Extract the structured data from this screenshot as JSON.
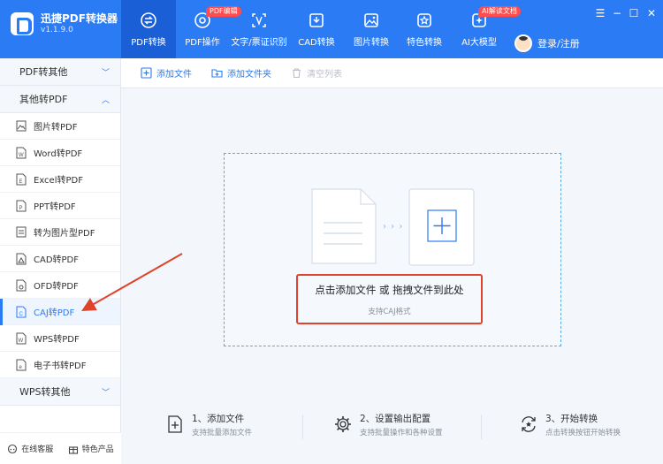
{
  "app": {
    "title": "迅捷PDF转换器",
    "version": "v1.1.9.0"
  },
  "nav": {
    "items": [
      {
        "label": "PDF转换",
        "icon": "pdf-convert-icon"
      },
      {
        "label": "PDF操作",
        "icon": "pdf-operation-icon",
        "badge": "PDF编辑"
      },
      {
        "label": "文字/票证识别",
        "icon": "ocr-frame-icon"
      },
      {
        "label": "CAD转换",
        "icon": "cad-convert-icon"
      },
      {
        "label": "图片转换",
        "icon": "image-convert-icon"
      },
      {
        "label": "特色转换",
        "icon": "feature-convert-icon"
      },
      {
        "label": "AI大模型",
        "icon": "ai-model-icon",
        "badge": "AI解读文档"
      }
    ],
    "login_label": "登录/注册"
  },
  "window": {
    "menu": "☰",
    "minimize": "−",
    "maximize": "☐",
    "close": "✕"
  },
  "sidebar": {
    "section_pdf_to_other": "PDF转其他",
    "section_other_to_pdf": "其他转PDF",
    "items": [
      {
        "label": "图片转PDF",
        "icon": "image-file-icon"
      },
      {
        "label": "Word转PDF",
        "icon": "word-file-icon"
      },
      {
        "label": "Excel转PDF",
        "icon": "excel-file-icon"
      },
      {
        "label": "PPT转PDF",
        "icon": "ppt-file-icon"
      },
      {
        "label": "转为图片型PDF",
        "icon": "image-pdf-file-icon"
      },
      {
        "label": "CAD转PDF",
        "icon": "cad-file-icon"
      },
      {
        "label": "OFD转PDF",
        "icon": "ofd-file-icon"
      },
      {
        "label": "CAJ转PDF",
        "icon": "caj-file-icon",
        "active": true
      },
      {
        "label": "WPS转PDF",
        "icon": "wps-file-icon"
      },
      {
        "label": "电子书转PDF",
        "icon": "ebook-file-icon"
      }
    ],
    "section_wps_to_other": "WPS转其他",
    "footer": {
      "service": "在线客服",
      "featured": "特色产品"
    }
  },
  "toolbar": {
    "add_file": "添加文件",
    "add_folder": "添加文件夹",
    "clear_list": "清空列表"
  },
  "dropzone": {
    "main_text": "点击添加文件 或 拖拽文件到此处",
    "sub_text": "支持CAJ格式",
    "arrows": "› › ›"
  },
  "steps": [
    {
      "title": "1、添加文件",
      "desc": "支持批量添加文件"
    },
    {
      "title": "2、设置输出配置",
      "desc": "支持批量操作和各种设置"
    },
    {
      "title": "3、开始转换",
      "desc": "点击转换按钮开始转换"
    }
  ],
  "colors": {
    "brand": "#2b7bf4",
    "highlight": "#e0432b",
    "badge": "#ff4d4f"
  }
}
